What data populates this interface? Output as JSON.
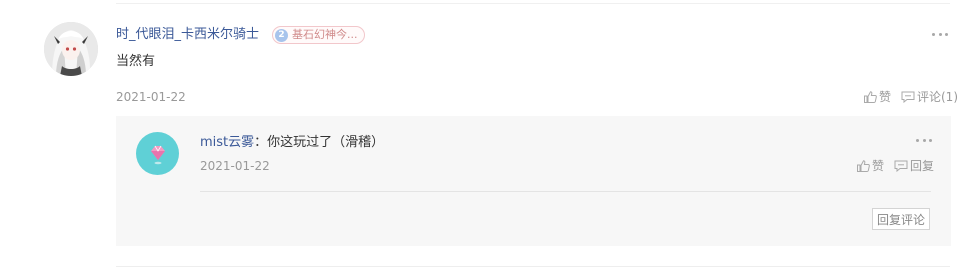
{
  "comment": {
    "author": "时_代眼泪_卡西米尔骑士",
    "medal": {
      "level": "2",
      "name": "基石幻神今..."
    },
    "content": "当然有",
    "date": "2021-01-22",
    "like_label": "赞",
    "comment_label": "评论(1)",
    "more_icon": "more-dots-icon"
  },
  "reply": {
    "author": "mist云雾",
    "separator": "：",
    "content": "你这玩过了（滑稽）",
    "date": "2021-01-22",
    "like_label": "赞",
    "reply_label": "回复",
    "reply_comment_button": "回复评论"
  },
  "colors": {
    "link": "#3b5998",
    "meta": "#999999",
    "reply_bg": "#f7f7f7",
    "reply_avatar_bg": "#5fd0d6"
  }
}
